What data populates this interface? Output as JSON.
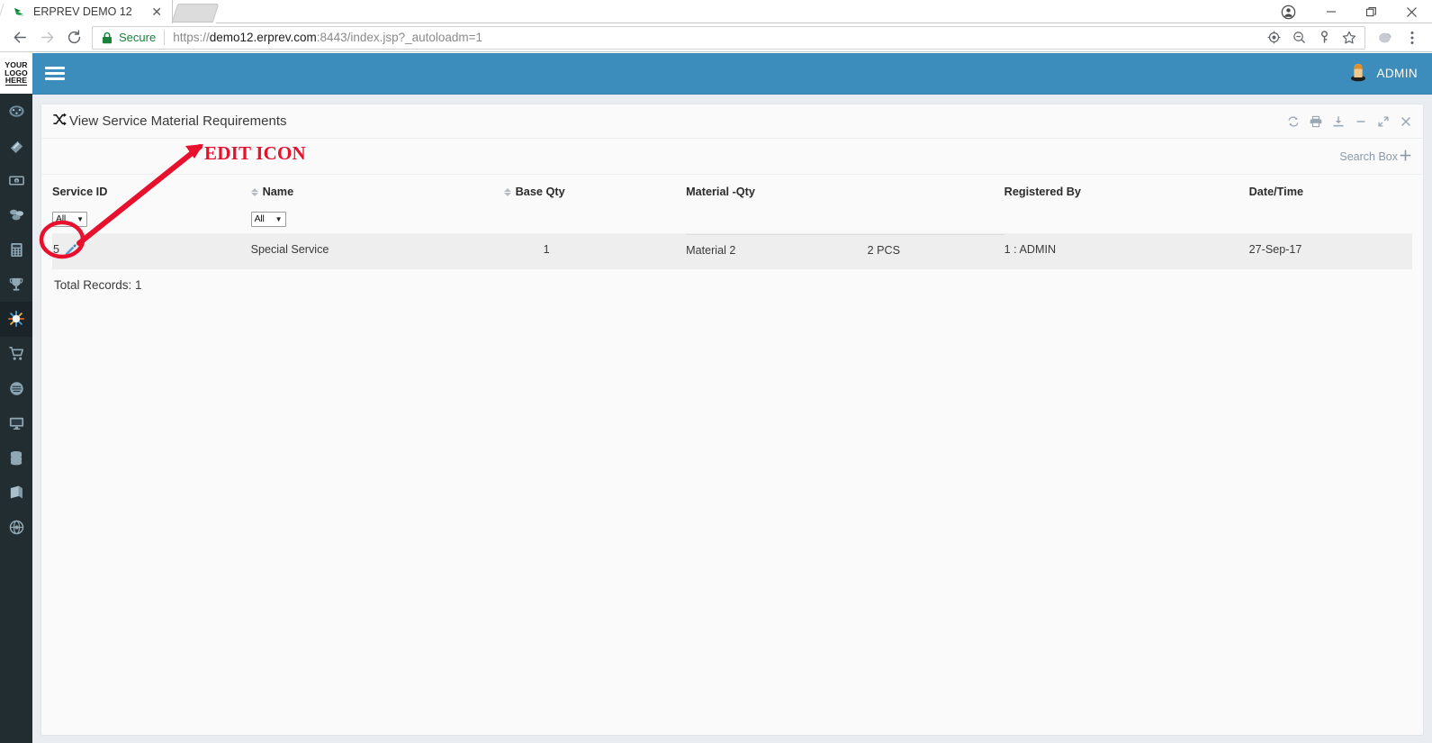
{
  "browser": {
    "tab": {
      "title": "ERPREV DEMO 12",
      "favicon": "bird-favicon",
      "close_label": "✕"
    },
    "new_tab_label": "new-tab",
    "window_controls": {
      "profile": "person-icon",
      "minimize": "—",
      "maximize": "❐",
      "close": "✕"
    },
    "nav": {
      "back": "←",
      "forward": "→",
      "reload": "↻"
    },
    "omnibox": {
      "security_label": "Secure",
      "lock_icon": "lock-icon",
      "url_scheme": "https://",
      "url_host": "demo12.erprev.com",
      "url_path": ":8443/index.jsp?_autoloadm=1",
      "full_url": "https://demo12.erprev.com:8443/index.jsp?_autoloadm=1",
      "icons": [
        "location-icon",
        "zoom-out-icon",
        "key-icon",
        "star-icon"
      ]
    },
    "toolbar_right": [
      "profile-avatar-icon",
      "menu-dots-icon"
    ]
  },
  "sidebar": {
    "logo": {
      "line1": "YOUR",
      "line2": "LOGO",
      "line3": "HERE"
    },
    "items": [
      {
        "icon": "dashboard-gauge-icon",
        "active": false
      },
      {
        "icon": "tag-icon",
        "active": false
      },
      {
        "icon": "money-icon",
        "active": false
      },
      {
        "icon": "boxes-icon",
        "active": false
      },
      {
        "icon": "calculator-icon",
        "active": false
      },
      {
        "icon": "trophy-icon",
        "active": false
      },
      {
        "icon": "snowflake-icon",
        "active": true
      },
      {
        "icon": "shopping-cart-icon",
        "active": false
      },
      {
        "icon": "disc-icon",
        "active": false
      },
      {
        "icon": "monitor-icon",
        "active": false
      },
      {
        "icon": "database-icon",
        "active": false
      },
      {
        "icon": "book-icon",
        "active": false
      },
      {
        "icon": "globe-icon",
        "active": false
      }
    ]
  },
  "navbar": {
    "menu_toggle": "hamburger-icon",
    "user": {
      "name": "ADMIN",
      "avatar": "user-avatar-icon"
    }
  },
  "panel": {
    "title": "View Service Material Requirements",
    "title_icon": "shuffle-icon",
    "tools": [
      {
        "name": "refresh-icon",
        "glyph": "↻"
      },
      {
        "name": "print-icon",
        "glyph": "⎙"
      },
      {
        "name": "download-icon",
        "glyph": "⬇"
      },
      {
        "name": "minimize-icon",
        "glyph": "—"
      },
      {
        "name": "expand-icon",
        "glyph": "⤡"
      },
      {
        "name": "close-icon",
        "glyph": "✕"
      }
    ],
    "search_box": {
      "label": "Search Box",
      "plus": "＋"
    }
  },
  "table": {
    "columns": [
      {
        "label": "Service ID",
        "sortable": false
      },
      {
        "label": "Name",
        "sortable": true
      },
      {
        "label": "Base Qty",
        "sortable": true
      },
      {
        "label": "Material -Qty",
        "sortable": false
      },
      {
        "label": "Registered By",
        "sortable": false
      },
      {
        "label": "Date/Time",
        "sortable": false
      }
    ],
    "filters": [
      {
        "column": "Service ID",
        "value": "All",
        "arrow": "▼"
      },
      {
        "column": "Name",
        "value": "All",
        "arrow": "▼"
      }
    ],
    "rows": [
      {
        "service_id": "5",
        "edit_icon": "pencil-edit-icon",
        "name": "Special Service",
        "base_qty": "1",
        "materials": [
          {
            "material": "Material 2",
            "qty": "2 PCS"
          }
        ],
        "registered_by": "1 : ADMIN",
        "date_time": "27-Sep-17"
      }
    ],
    "total_records": "Total Records: 1"
  },
  "annotation": {
    "label": "EDIT ICON",
    "color": "#e8112d",
    "target": "edit-icon-in-first-row"
  },
  "colors": {
    "navbar_blue": "#3c8dbc",
    "sidebar_dark": "#222d32",
    "app_bg": "#e9edf2",
    "row_bg": "#eeeeee",
    "annotation_red": "#e8112d",
    "secure_green": "#178239"
  }
}
